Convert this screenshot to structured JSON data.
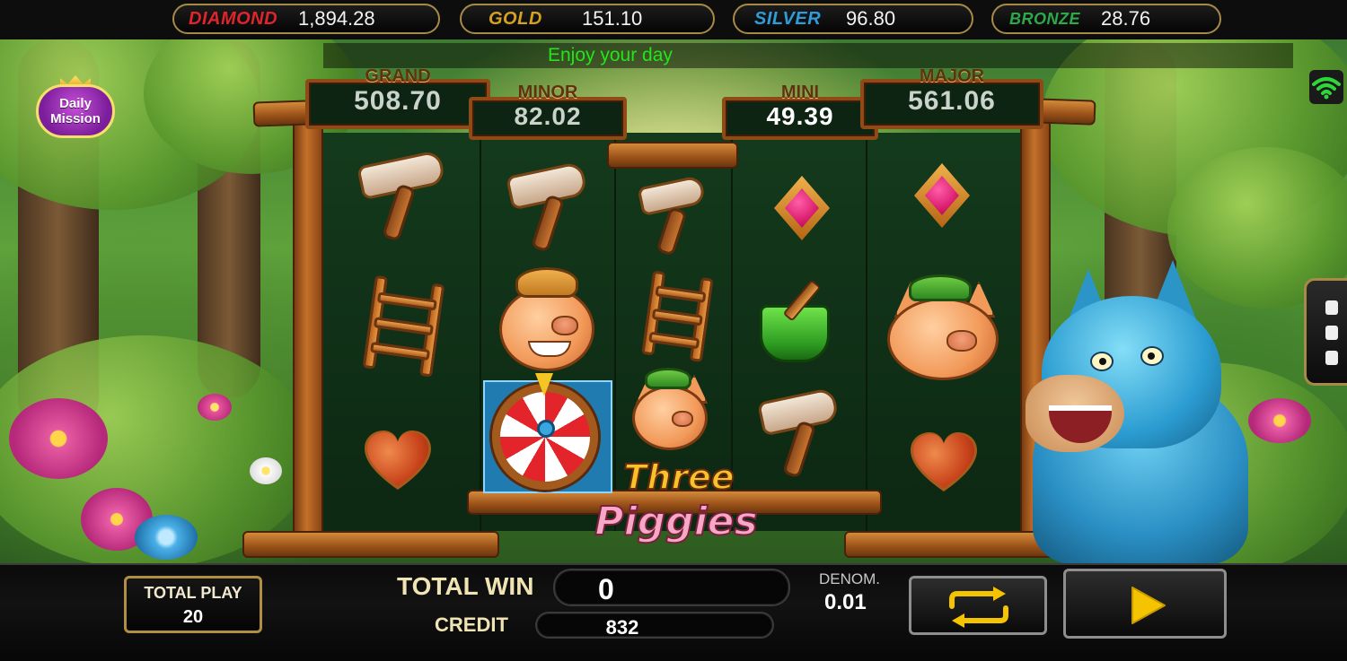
{
  "top_jackpots": [
    {
      "label": "DIAMOND",
      "value": "1,894.28",
      "color": "#e0242b"
    },
    {
      "label": "GOLD",
      "value": "151.10",
      "color": "#d4a21e"
    },
    {
      "label": "SILVER",
      "value": "96.80",
      "color": "#2f9bd9"
    },
    {
      "label": "BRONZE",
      "value": "28.76",
      "color": "#2fa84a"
    }
  ],
  "marquee_text": "Enjoy your day",
  "daily_mission": {
    "line1": "Daily",
    "line2": "Mission"
  },
  "reel_jackpots": {
    "grand": {
      "title": "GRAND",
      "value": "508.70"
    },
    "minor": {
      "title": "MINOR",
      "value": "82.02"
    },
    "mini": {
      "title": "MINI",
      "value": "49.39"
    },
    "major": {
      "title": "MAJOR",
      "value": "561.06"
    }
  },
  "reels": [
    [
      "hammer",
      "ladder",
      "heart"
    ],
    [
      "hammer",
      "pig-strawhat",
      "wheel"
    ],
    [
      "hammer",
      "ladder",
      "pig-cap"
    ],
    [
      "gem",
      "paint-bucket",
      "hammer"
    ],
    [
      "gem",
      "pig-cap",
      "heart"
    ]
  ],
  "logo": {
    "line1": "Three",
    "line2": "Piggies"
  },
  "controls": {
    "total_play_label": "TOTAL PLAY",
    "total_play_value": "20",
    "total_win_label": "TOTAL WIN",
    "total_win_value": "0",
    "credit_label": "CREDIT",
    "credit_value": "832",
    "denom_label": "DENOM.",
    "denom_value": "0.01",
    "autoplay_icon": "repeat-icon",
    "spin_icon": "play-icon"
  },
  "colors": {
    "marquee": "#23e51c",
    "accent_gold": "#b08f45",
    "spin_arrow": "#f5c400"
  }
}
